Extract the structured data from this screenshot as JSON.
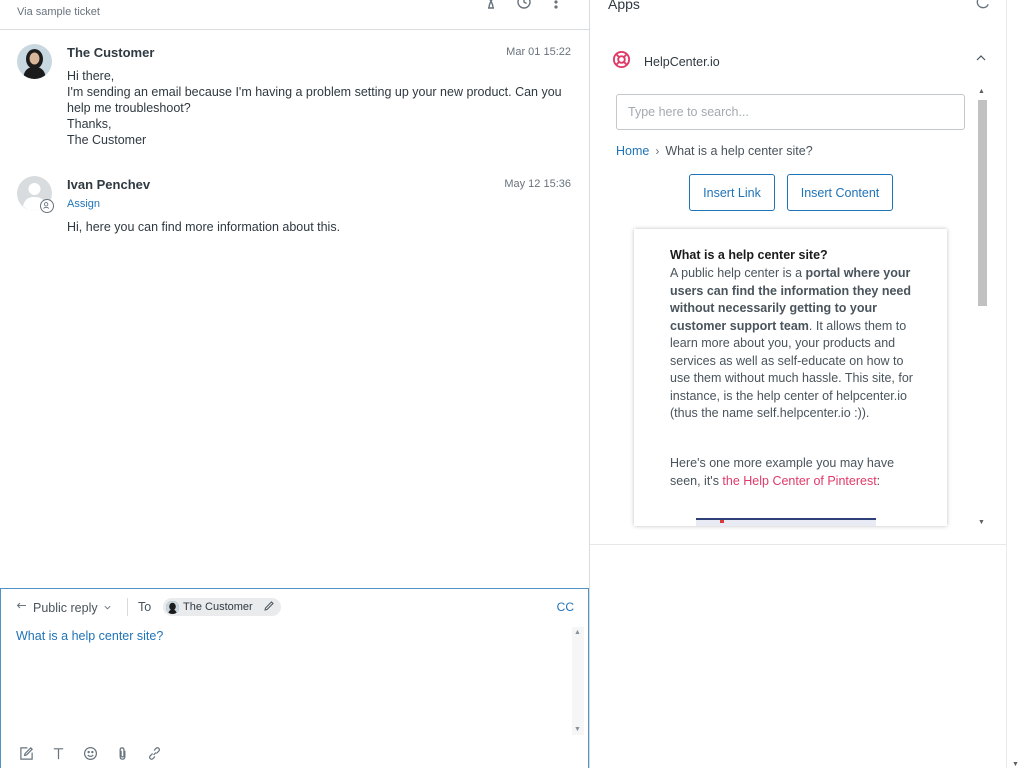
{
  "ticket": {
    "via": "Via sample ticket"
  },
  "messages": [
    {
      "author": "The Customer",
      "date": "Mar 01 15:22",
      "lines": [
        "Hi there,",
        "I'm sending an email because I'm having a problem setting up your new product. Can you help me troubleshoot?",
        "Thanks,",
        "The Customer"
      ]
    },
    {
      "author": "Ivan Penchev",
      "date": "May 12 15:36",
      "assign": "Assign",
      "lines": [
        "Hi, here you can find more information about this."
      ]
    }
  ],
  "composer": {
    "reply_type": "Public reply",
    "to_label": "To",
    "recipient": "The Customer",
    "cc": "CC",
    "text": "What is a help center site?"
  },
  "apps": {
    "title": "Apps",
    "app_name": "HelpCenter.io",
    "accent": "#e03a68",
    "search_placeholder": "Type here to search...",
    "breadcrumb_home": "Home",
    "breadcrumb_current": "What is a help center site?",
    "insert_link": "Insert Link",
    "insert_content": "Insert Content",
    "article": {
      "title": "What is a help center site?",
      "p1_lead": "A public help center is a ",
      "p1_bold": "portal where your users can find the information they need without necessarily getting to your customer support team",
      "p1_rest": ". It allows them to learn more about you, your products and services as well as self-educate on how to use them without much hassle. This site, for instance, is the help center of helpcenter.io (thus the name self.helpcenter.io :)).",
      "p2_lead": "Here's one more example you may have seen, it's ",
      "p2_link": "the Help Center of Pinterest",
      "p2_end": ":"
    }
  },
  "icons": {
    "header": [
      "hourglass-icon",
      "clock-icon",
      "more-vertical-icon"
    ],
    "toolbar": [
      "edit-icon",
      "text-format-icon",
      "emoji-icon",
      "attachment-icon",
      "link-icon"
    ]
  }
}
